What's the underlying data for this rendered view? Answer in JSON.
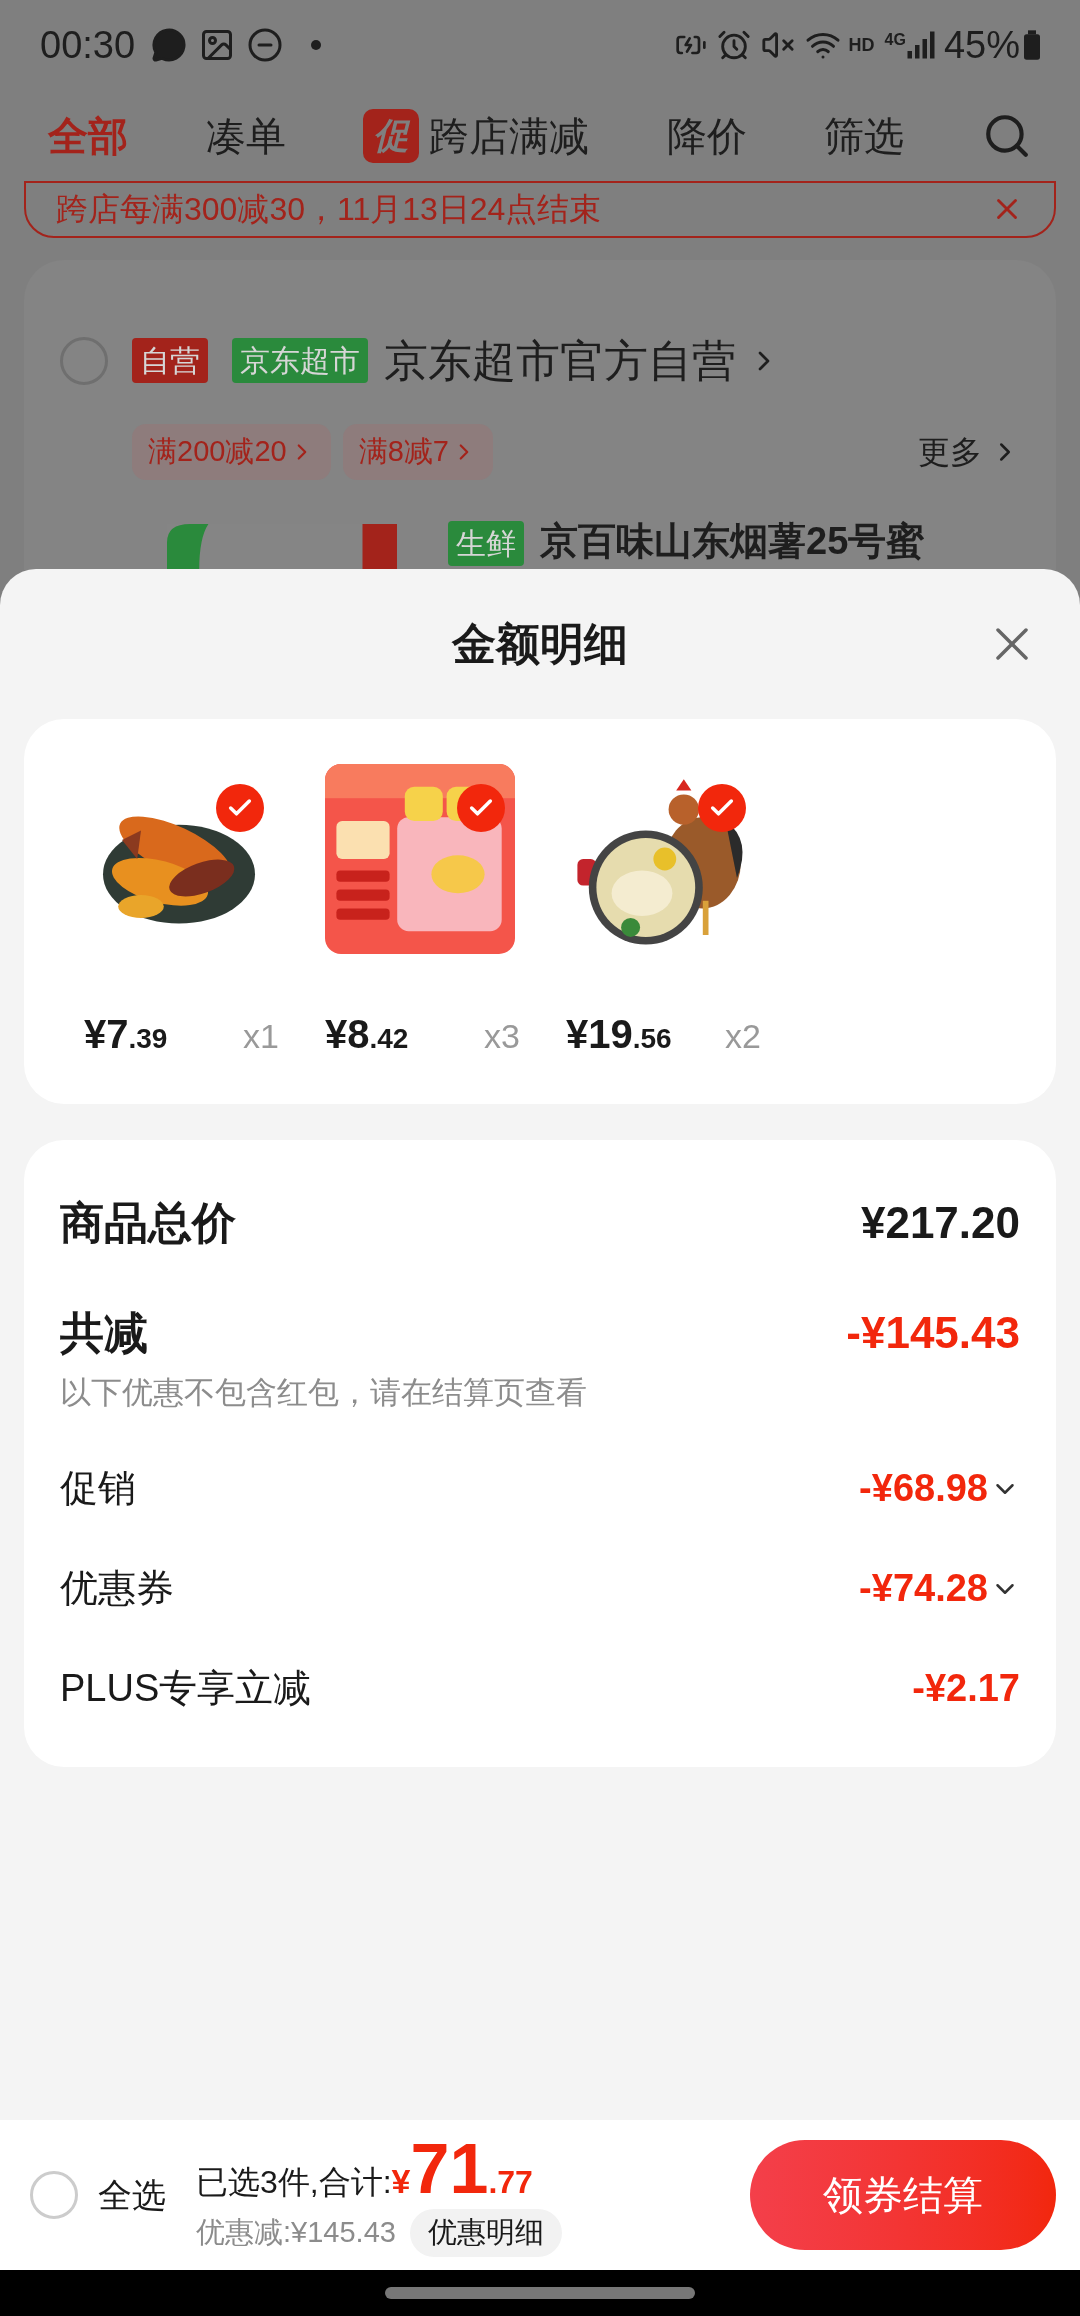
{
  "status_bar": {
    "time": "00:30",
    "network_labels": [
      "HD",
      "4G"
    ],
    "battery": "45%"
  },
  "tabs": [
    {
      "label": "全部",
      "selected": true
    },
    {
      "label": "凑单",
      "selected": false
    },
    {
      "label": "跨店满减",
      "badge": "促",
      "selected": false
    },
    {
      "label": "降价",
      "selected": false
    },
    {
      "label": "筛选",
      "selected": false
    }
  ],
  "promo_banner": {
    "text": "跨店每满300减30，11月13日24点结束"
  },
  "store": {
    "checked": false,
    "tags": [
      {
        "text": "自营",
        "color": "#a3231b"
      },
      {
        "text": "京东超市",
        "color": "#2a8a3c"
      }
    ],
    "name": "京东超市官方自营",
    "offers": [
      "满200减20",
      "满8减7"
    ],
    "more": "更多",
    "product": {
      "tag": "生鲜",
      "title": "京百味山东烟薯25号蜜"
    }
  },
  "sheet": {
    "title": "金额明细",
    "items": [
      {
        "kind": "potato",
        "price_int": "¥7",
        "price_dec": ".39",
        "qty": "x1",
        "selected": true
      },
      {
        "kind": "box",
        "price_int": "¥8",
        "price_dec": ".42",
        "qty": "x3",
        "selected": true
      },
      {
        "kind": "chicken",
        "price_int": "¥19",
        "price_dec": ".56",
        "qty": "x2",
        "selected": true
      }
    ],
    "summary": {
      "total": {
        "label": "商品总价",
        "value": "¥217.20"
      },
      "discount": {
        "label": "共减",
        "value": "-¥145.43",
        "note": "以下优惠不包含红包，请在结算页查看"
      },
      "lines": [
        {
          "label": "促销",
          "value": "-¥68.98",
          "expandable": true
        },
        {
          "label": "优惠券",
          "value": "-¥74.28",
          "expandable": true
        },
        {
          "label": "PLUS专享立减",
          "value": "-¥2.17",
          "expandable": false
        }
      ]
    }
  },
  "footer": {
    "select_all": {
      "label": "全选",
      "checked": false
    },
    "summary": "已选3件,合计:",
    "currency": "¥",
    "total_int": "71",
    "total_dec": ".77",
    "discount": "优惠减:¥145.43",
    "details_button": "优惠明细",
    "checkout_button": "领券结算"
  }
}
